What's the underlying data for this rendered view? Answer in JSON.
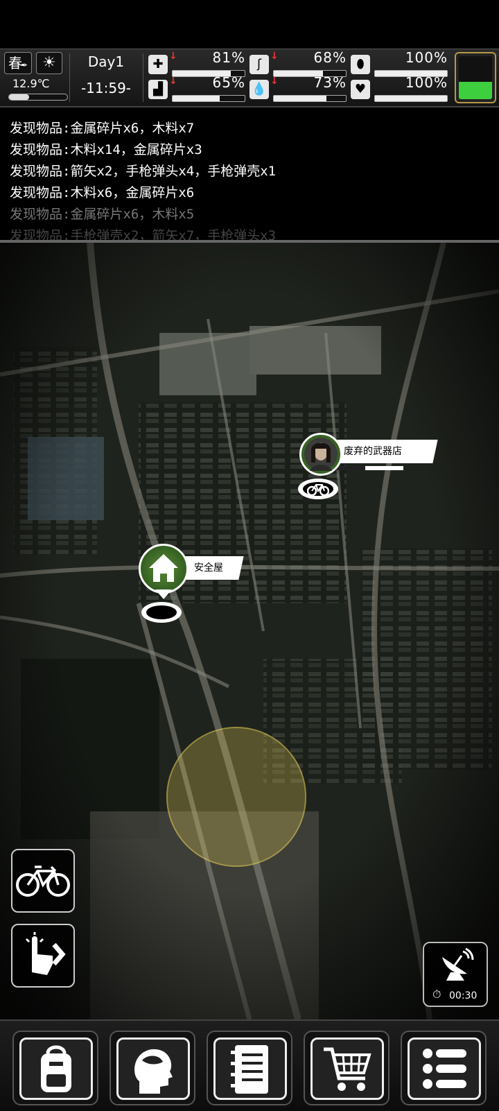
{
  "topbar": {
    "season": "春",
    "weather_icon": "sun-icon",
    "temperature": "12.9℃",
    "temperature_level": 0.35,
    "day": "Day1",
    "time": "-11:59-",
    "stats": [
      {
        "name": "health",
        "icon": "medkit-icon",
        "percent": "81%",
        "value": 81,
        "decreasing": true
      },
      {
        "name": "hunger",
        "icon": "stomach-icon",
        "percent": "68%",
        "value": 68,
        "decreasing": true
      },
      {
        "name": "pill",
        "icon": "pill-icon",
        "percent": "100%",
        "value": 100,
        "decreasing": false
      },
      {
        "name": "stamina",
        "icon": "boot-icon",
        "percent": "65%",
        "value": 65,
        "decreasing": true
      },
      {
        "name": "thirst",
        "icon": "water-drop-icon",
        "percent": "73%",
        "value": 73,
        "decreasing": true
      },
      {
        "name": "mood",
        "icon": "heart-icon",
        "percent": "100%",
        "value": 100,
        "decreasing": false
      }
    ],
    "battery_level": 0.4,
    "battery_color": "#3ecf3e"
  },
  "log": [
    "发现物品:金属碎片x6，木料x7",
    "发现物品:木料x14，金属碎片x3",
    "发现物品:箭矢x2，手枪弹头x4，手枪弹壳x1",
    "发现物品:木料x6，金属碎片x6",
    "发现物品:金属碎片x6，木料x5",
    "发现物品:手枪弹壳x2，箭矢x7，手枪弹头x3"
  ],
  "map": {
    "locations": [
      {
        "name": "废弃的武器店",
        "icon": "survivor-portrait-icon",
        "travel": "bicycle-icon",
        "progress": 0.45
      },
      {
        "name": "安全屋",
        "icon": "house-icon",
        "travel": "none"
      }
    ],
    "radio_timer": "00:30",
    "scan_color": "#e6d25a"
  },
  "side_buttons": {
    "bicycle": "bicycle-icon",
    "interact": "tap-hand-icon"
  },
  "bottom_nav": [
    {
      "name": "backpack",
      "icon": "backpack-icon"
    },
    {
      "name": "skills",
      "icon": "brain-head-icon"
    },
    {
      "name": "journal",
      "icon": "notebook-icon"
    },
    {
      "name": "shop",
      "icon": "cart-icon"
    },
    {
      "name": "menu",
      "icon": "list-menu-icon"
    }
  ]
}
